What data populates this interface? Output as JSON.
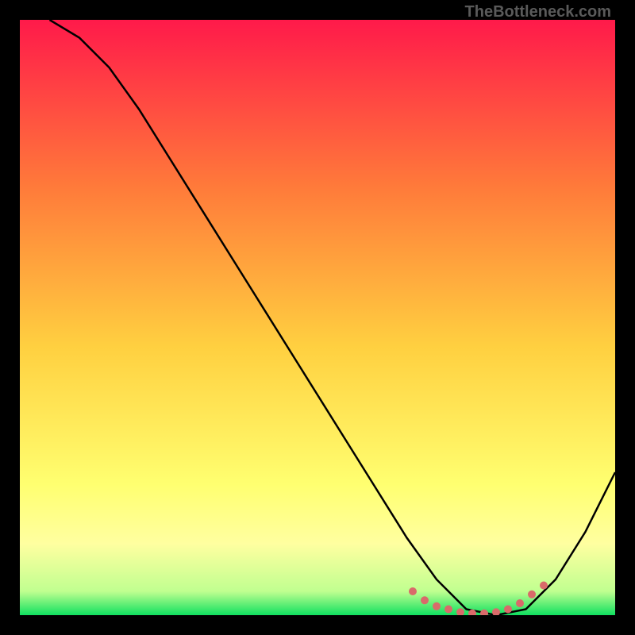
{
  "watermark": "TheBottleneck.com",
  "chart_data": {
    "type": "line",
    "title": "",
    "xlabel": "",
    "ylabel": "",
    "xlim": [
      0,
      100
    ],
    "ylim": [
      0,
      100
    ],
    "gradient_note": "Background vertical gradient: red (top, high bottleneck) → orange → yellow → green (bottom, no bottleneck)",
    "curve_description": "Bottleneck percentage curve that descends steeply from near 100% at left edge to ~0% (the sweet spot) at roughly x=70-85, then rises again toward the right edge",
    "series": [
      {
        "name": "bottleneck-curve",
        "x": [
          5,
          10,
          15,
          20,
          25,
          30,
          35,
          40,
          45,
          50,
          55,
          60,
          65,
          70,
          75,
          80,
          85,
          90,
          95,
          100
        ],
        "y": [
          100,
          97,
          92,
          85,
          77,
          69,
          61,
          53,
          45,
          37,
          29,
          21,
          13,
          6,
          1,
          0,
          1,
          6,
          14,
          24
        ]
      },
      {
        "name": "optimal-range-dots",
        "x": [
          66,
          68,
          70,
          72,
          74,
          76,
          78,
          80,
          82,
          84,
          86,
          88
        ],
        "y": [
          4,
          2.5,
          1.5,
          1,
          0.5,
          0.3,
          0.3,
          0.5,
          1,
          2,
          3.5,
          5
        ]
      }
    ]
  },
  "colors": {
    "gradient_top": "#ff1a4a",
    "gradient_mid1": "#ff7a3a",
    "gradient_mid2": "#ffd040",
    "gradient_mid3": "#ffff70",
    "gradient_bot": "#10e060",
    "curve": "#000000",
    "dots": "#d96a6a",
    "watermark": "#5a5a5a",
    "frame": "#000000"
  }
}
